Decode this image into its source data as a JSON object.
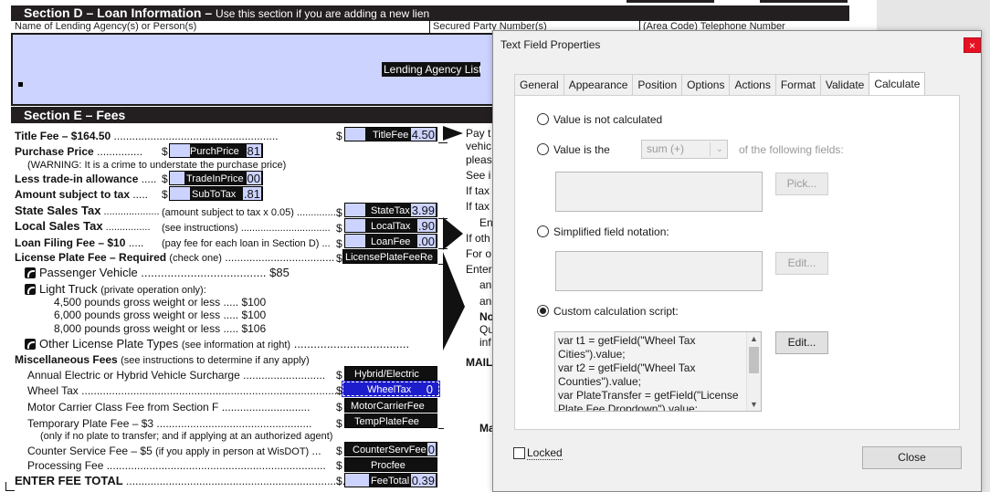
{
  "form": {
    "section_d": {
      "title": "Section D – Loan Information –",
      "subtitle": "Use this section if you are adding a new lien",
      "col_lender": "Name of Lending Agency(s) or Person(s)",
      "col_secured": "Secured Party Number(s)",
      "col_phone": "(Area Code) Telephone Number",
      "lender_list": "Lending Agency List"
    },
    "section_e": {
      "title": "Section E – Fees",
      "title_fee": "Title Fee – $164.50",
      "purchase_price": "Purchase Price",
      "warning": "(WARNING: It is a crime to understate the purchase price)",
      "trade_in": "Less trade-in allowance",
      "amount_subject": "Amount subject to tax",
      "state_tax": "State Sales Tax",
      "state_tax_note": "(amount subject to tax x 0.05)",
      "local_tax": "Local Sales Tax",
      "local_tax_note": "(see instructions)",
      "loan_fee": "Loan Filing Fee – $10",
      "loan_fee_note": "(pay fee for each loan in Section D)",
      "plate_fee": "License Plate Fee – Required",
      "plate_fee_note": "(check one)",
      "passenger": "Passenger Vehicle",
      "passenger_amt": "$85",
      "light_truck": "Light Truck",
      "light_truck_note": "(private operation only):",
      "truck_4500": "4,500 pounds gross weight or less",
      "truck_4500_amt": "$100",
      "truck_6000": "6,000 pounds gross weight or less",
      "truck_6000_amt": "$100",
      "truck_8000": "8,000 pounds gross weight or less",
      "truck_8000_amt": "$106",
      "other_plate": "Other License Plate Types",
      "other_plate_note": "(see information at right)",
      "misc_fees": "Miscellaneous Fees",
      "misc_fees_note": "(see instructions to determine if any apply)",
      "electric": "Annual Electric or Hybrid Vehicle Surcharge",
      "wheel_tax": "Wheel Tax",
      "motor_carrier": "Motor Carrier Class Fee from Section F",
      "temp_plate": "Temporary Plate Fee – $3",
      "temp_plate_note": "(only if no plate to transfer; and if applying at an authorized agent)",
      "counter": "Counter Service Fee – $5",
      "counter_note": "(if you apply in person at WisDOT)",
      "processing": "Processing Fee",
      "total": "ENTER FEE TOTAL",
      "dollar": "$"
    },
    "fields": {
      "title_fee": {
        "name": "TitleFee",
        "value": "4.50"
      },
      "purch_price": {
        "name": "PurchPrice",
        "value": "81"
      },
      "trade_in": {
        "name": "TradeInPrice",
        "value": "00"
      },
      "sub_tax": {
        "name": "SubToTax",
        "value": ".81"
      },
      "state_tax": {
        "name": "StateTax",
        "value": "3.99"
      },
      "local_tax": {
        "name": "LocalTax",
        "value": ".90"
      },
      "loan_fee": {
        "name": "LoanFee",
        "value": ".00"
      },
      "plate_fee": {
        "name": "LicensePlateFeeRe"
      },
      "hybrid": {
        "name": "Hybrid/Electric"
      },
      "wheel_tax": {
        "name": "WheelTax",
        "value": "0"
      },
      "motor_carrier": {
        "name": "MotorCarrierFee"
      },
      "temp_plate": {
        "name": "TempPlateFee"
      },
      "counter": {
        "name": "CounterServFee",
        "value": "0"
      },
      "proc": {
        "name": "Procfee"
      },
      "fee_total": {
        "name": "FeeTotal",
        "value": "0.39"
      }
    },
    "right_col": [
      "Pay t",
      "vehic",
      "pleas",
      "See i",
      "If tax",
      "If tax",
      "En",
      "If oth",
      "For o",
      "Enter",
      "an",
      "an",
      "No",
      "Qu",
      "inf",
      "MAIL",
      "Ma"
    ]
  },
  "dialog": {
    "title": "Text Field Properties",
    "close_glyph": "×",
    "tabs": [
      "General",
      "Appearance",
      "Position",
      "Options",
      "Actions",
      "Format",
      "Validate",
      "Calculate"
    ],
    "active_tab": "Calculate",
    "options": {
      "not_calculated": "Value is not calculated",
      "value_is_the": "Value is the",
      "operation": "sum (+)",
      "following_fields": "of the following fields:",
      "pick": "Pick...",
      "simplified": "Simplified field notation:",
      "edit1": "Edit...",
      "custom": "Custom calculation script:",
      "edit2": "Edit...",
      "selected": "custom"
    },
    "script": "var t1 = getField(\"Wheel Tax Cities\").value;\nvar t2 = getField(\"Wheel Tax Counties\").value;\nvar PlateTransfer = getField(\"License Plate Fee Dropdown\").value;",
    "locked_label": "Locked",
    "locked": false,
    "close_button": "Close"
  }
}
